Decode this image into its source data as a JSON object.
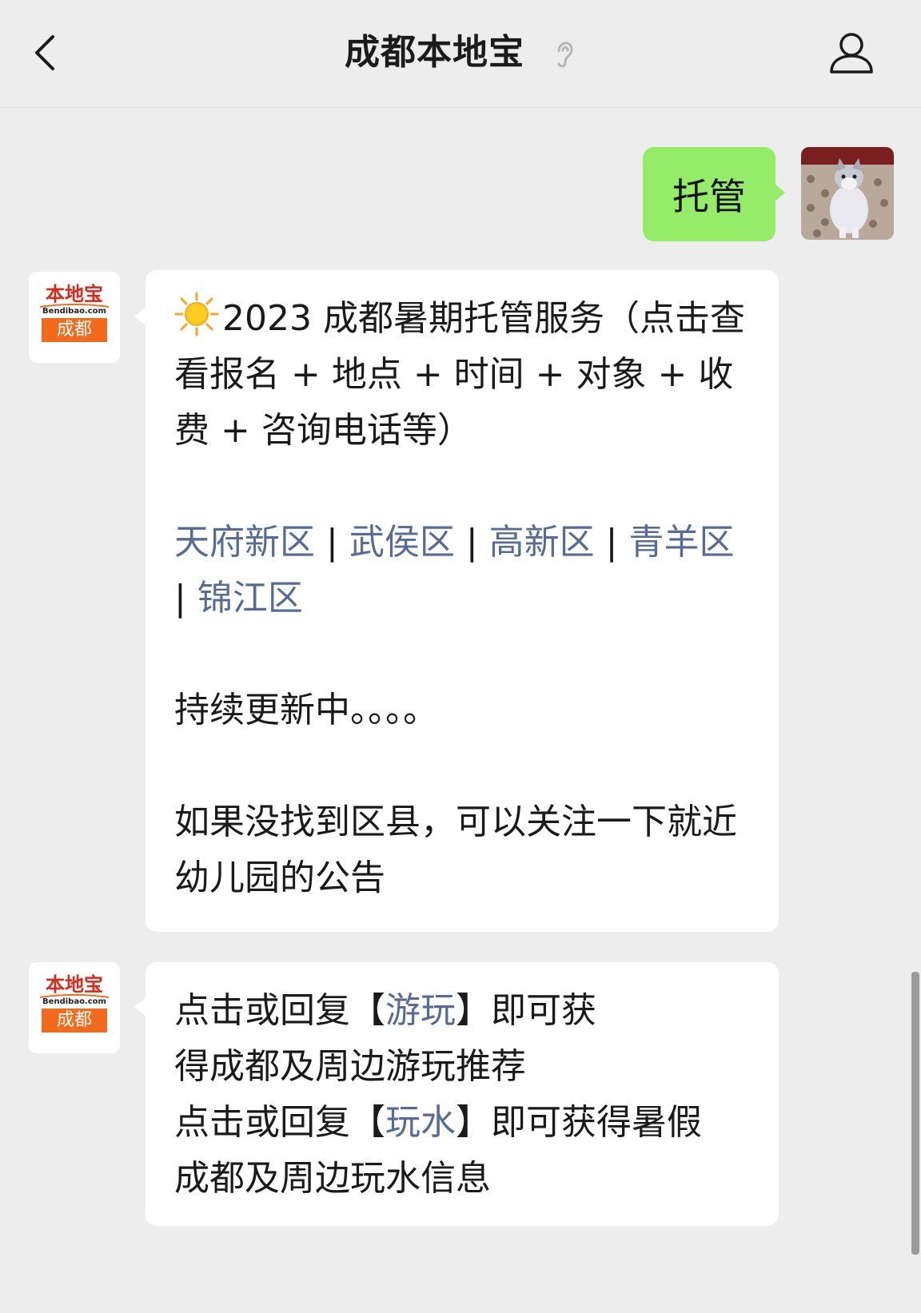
{
  "header": {
    "title": "成都本地宝"
  },
  "outgoing_message": {
    "text": "托管"
  },
  "bot": {
    "avatar_logo_top": "本地宝",
    "avatar_logo_domain": "Bendibao.com",
    "avatar_logo_city": "成都"
  },
  "message1": {
    "intro": "2023 成都暑期托管服务（点击查看报名 + 地点 + 时间 + 对象 + 收费 + 咨询电话等）",
    "districts": [
      {
        "label": "天府新区"
      },
      {
        "label": "武侯区"
      },
      {
        "label": "高新区"
      },
      {
        "label": "青羊区"
      },
      {
        "label": "锦江区"
      }
    ],
    "separator": "|",
    "updating": "持续更新中。。。。",
    "note": "如果没找到区县，可以关注一下就近幼儿园的公告"
  },
  "message2": {
    "line1_prefix": "点击或回复【",
    "line1_link": "游玩",
    "line1_suffix": "】即可获",
    "line2": "得成都及周边游玩推荐",
    "line3_prefix": "点击或回复【",
    "line3_link": "玩水",
    "line3_suffix": "】即可获得暑假",
    "line4": "成都及周边玩水信息"
  },
  "colors": {
    "background": "#ededed",
    "outgoing_bubble": "#95ec69",
    "incoming_bubble": "#ffffff",
    "link": "#576b95",
    "logo_orange": "#f26a1b",
    "logo_red": "#d7281c"
  },
  "icons": [
    "back-arrow-icon",
    "ear-icon",
    "user-profile-icon",
    "sun-icon"
  ]
}
